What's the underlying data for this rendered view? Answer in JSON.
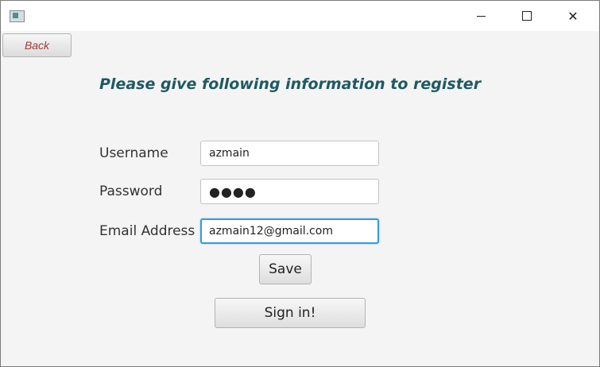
{
  "titlebar": {
    "icons": {
      "app": "app-icon",
      "minimize": "minimize-icon",
      "maximize": "maximize-icon",
      "close": "close-icon"
    },
    "close_glyph": "✕"
  },
  "nav": {
    "back_label": "Back"
  },
  "form": {
    "heading": "Please give following information to register",
    "username": {
      "label": "Username",
      "value": "azmain"
    },
    "password": {
      "label": "Password",
      "value": "●●●●"
    },
    "email": {
      "label": "Email Address",
      "value": "azmain12@gmail.com"
    }
  },
  "actions": {
    "save_label": "Save",
    "signin_label": "Sign in!"
  },
  "colors": {
    "heading": "#1e5a63",
    "back_text": "#a33a3a",
    "focus_border": "#3b99d9"
  }
}
